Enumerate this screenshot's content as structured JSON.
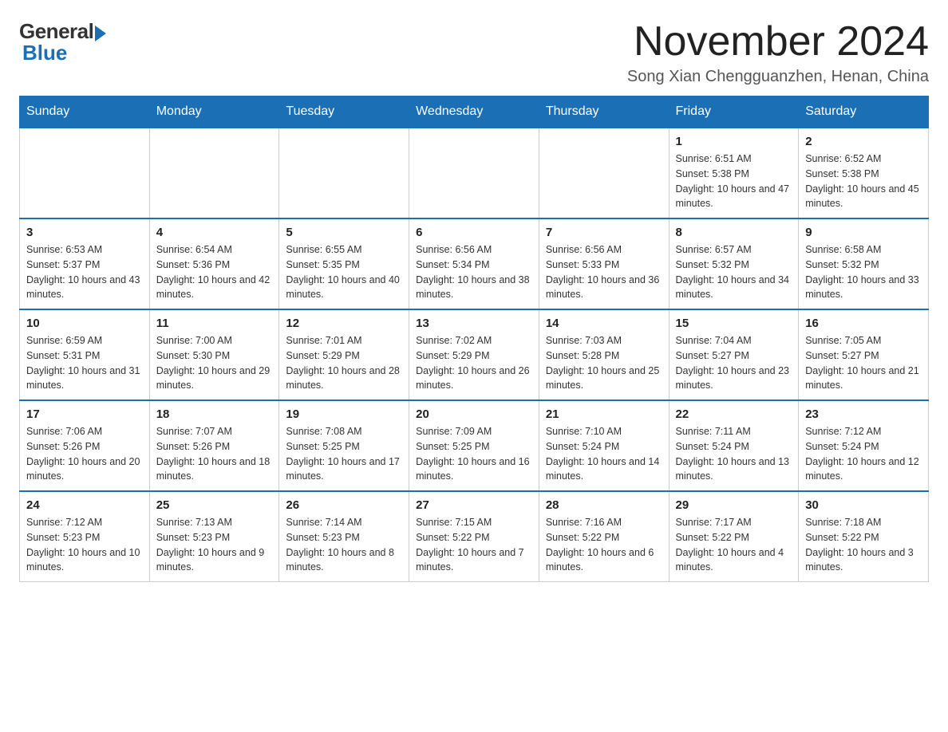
{
  "logo": {
    "general": "General",
    "blue": "Blue"
  },
  "header": {
    "month": "November 2024",
    "location": "Song Xian Chengguanzhen, Henan, China"
  },
  "days_of_week": [
    "Sunday",
    "Monday",
    "Tuesday",
    "Wednesday",
    "Thursday",
    "Friday",
    "Saturday"
  ],
  "weeks": [
    [
      {
        "day": "",
        "info": ""
      },
      {
        "day": "",
        "info": ""
      },
      {
        "day": "",
        "info": ""
      },
      {
        "day": "",
        "info": ""
      },
      {
        "day": "",
        "info": ""
      },
      {
        "day": "1",
        "info": "Sunrise: 6:51 AM\nSunset: 5:38 PM\nDaylight: 10 hours and 47 minutes."
      },
      {
        "day": "2",
        "info": "Sunrise: 6:52 AM\nSunset: 5:38 PM\nDaylight: 10 hours and 45 minutes."
      }
    ],
    [
      {
        "day": "3",
        "info": "Sunrise: 6:53 AM\nSunset: 5:37 PM\nDaylight: 10 hours and 43 minutes."
      },
      {
        "day": "4",
        "info": "Sunrise: 6:54 AM\nSunset: 5:36 PM\nDaylight: 10 hours and 42 minutes."
      },
      {
        "day": "5",
        "info": "Sunrise: 6:55 AM\nSunset: 5:35 PM\nDaylight: 10 hours and 40 minutes."
      },
      {
        "day": "6",
        "info": "Sunrise: 6:56 AM\nSunset: 5:34 PM\nDaylight: 10 hours and 38 minutes."
      },
      {
        "day": "7",
        "info": "Sunrise: 6:56 AM\nSunset: 5:33 PM\nDaylight: 10 hours and 36 minutes."
      },
      {
        "day": "8",
        "info": "Sunrise: 6:57 AM\nSunset: 5:32 PM\nDaylight: 10 hours and 34 minutes."
      },
      {
        "day": "9",
        "info": "Sunrise: 6:58 AM\nSunset: 5:32 PM\nDaylight: 10 hours and 33 minutes."
      }
    ],
    [
      {
        "day": "10",
        "info": "Sunrise: 6:59 AM\nSunset: 5:31 PM\nDaylight: 10 hours and 31 minutes."
      },
      {
        "day": "11",
        "info": "Sunrise: 7:00 AM\nSunset: 5:30 PM\nDaylight: 10 hours and 29 minutes."
      },
      {
        "day": "12",
        "info": "Sunrise: 7:01 AM\nSunset: 5:29 PM\nDaylight: 10 hours and 28 minutes."
      },
      {
        "day": "13",
        "info": "Sunrise: 7:02 AM\nSunset: 5:29 PM\nDaylight: 10 hours and 26 minutes."
      },
      {
        "day": "14",
        "info": "Sunrise: 7:03 AM\nSunset: 5:28 PM\nDaylight: 10 hours and 25 minutes."
      },
      {
        "day": "15",
        "info": "Sunrise: 7:04 AM\nSunset: 5:27 PM\nDaylight: 10 hours and 23 minutes."
      },
      {
        "day": "16",
        "info": "Sunrise: 7:05 AM\nSunset: 5:27 PM\nDaylight: 10 hours and 21 minutes."
      }
    ],
    [
      {
        "day": "17",
        "info": "Sunrise: 7:06 AM\nSunset: 5:26 PM\nDaylight: 10 hours and 20 minutes."
      },
      {
        "day": "18",
        "info": "Sunrise: 7:07 AM\nSunset: 5:26 PM\nDaylight: 10 hours and 18 minutes."
      },
      {
        "day": "19",
        "info": "Sunrise: 7:08 AM\nSunset: 5:25 PM\nDaylight: 10 hours and 17 minutes."
      },
      {
        "day": "20",
        "info": "Sunrise: 7:09 AM\nSunset: 5:25 PM\nDaylight: 10 hours and 16 minutes."
      },
      {
        "day": "21",
        "info": "Sunrise: 7:10 AM\nSunset: 5:24 PM\nDaylight: 10 hours and 14 minutes."
      },
      {
        "day": "22",
        "info": "Sunrise: 7:11 AM\nSunset: 5:24 PM\nDaylight: 10 hours and 13 minutes."
      },
      {
        "day": "23",
        "info": "Sunrise: 7:12 AM\nSunset: 5:24 PM\nDaylight: 10 hours and 12 minutes."
      }
    ],
    [
      {
        "day": "24",
        "info": "Sunrise: 7:12 AM\nSunset: 5:23 PM\nDaylight: 10 hours and 10 minutes."
      },
      {
        "day": "25",
        "info": "Sunrise: 7:13 AM\nSunset: 5:23 PM\nDaylight: 10 hours and 9 minutes."
      },
      {
        "day": "26",
        "info": "Sunrise: 7:14 AM\nSunset: 5:23 PM\nDaylight: 10 hours and 8 minutes."
      },
      {
        "day": "27",
        "info": "Sunrise: 7:15 AM\nSunset: 5:22 PM\nDaylight: 10 hours and 7 minutes."
      },
      {
        "day": "28",
        "info": "Sunrise: 7:16 AM\nSunset: 5:22 PM\nDaylight: 10 hours and 6 minutes."
      },
      {
        "day": "29",
        "info": "Sunrise: 7:17 AM\nSunset: 5:22 PM\nDaylight: 10 hours and 4 minutes."
      },
      {
        "day": "30",
        "info": "Sunrise: 7:18 AM\nSunset: 5:22 PM\nDaylight: 10 hours and 3 minutes."
      }
    ]
  ]
}
